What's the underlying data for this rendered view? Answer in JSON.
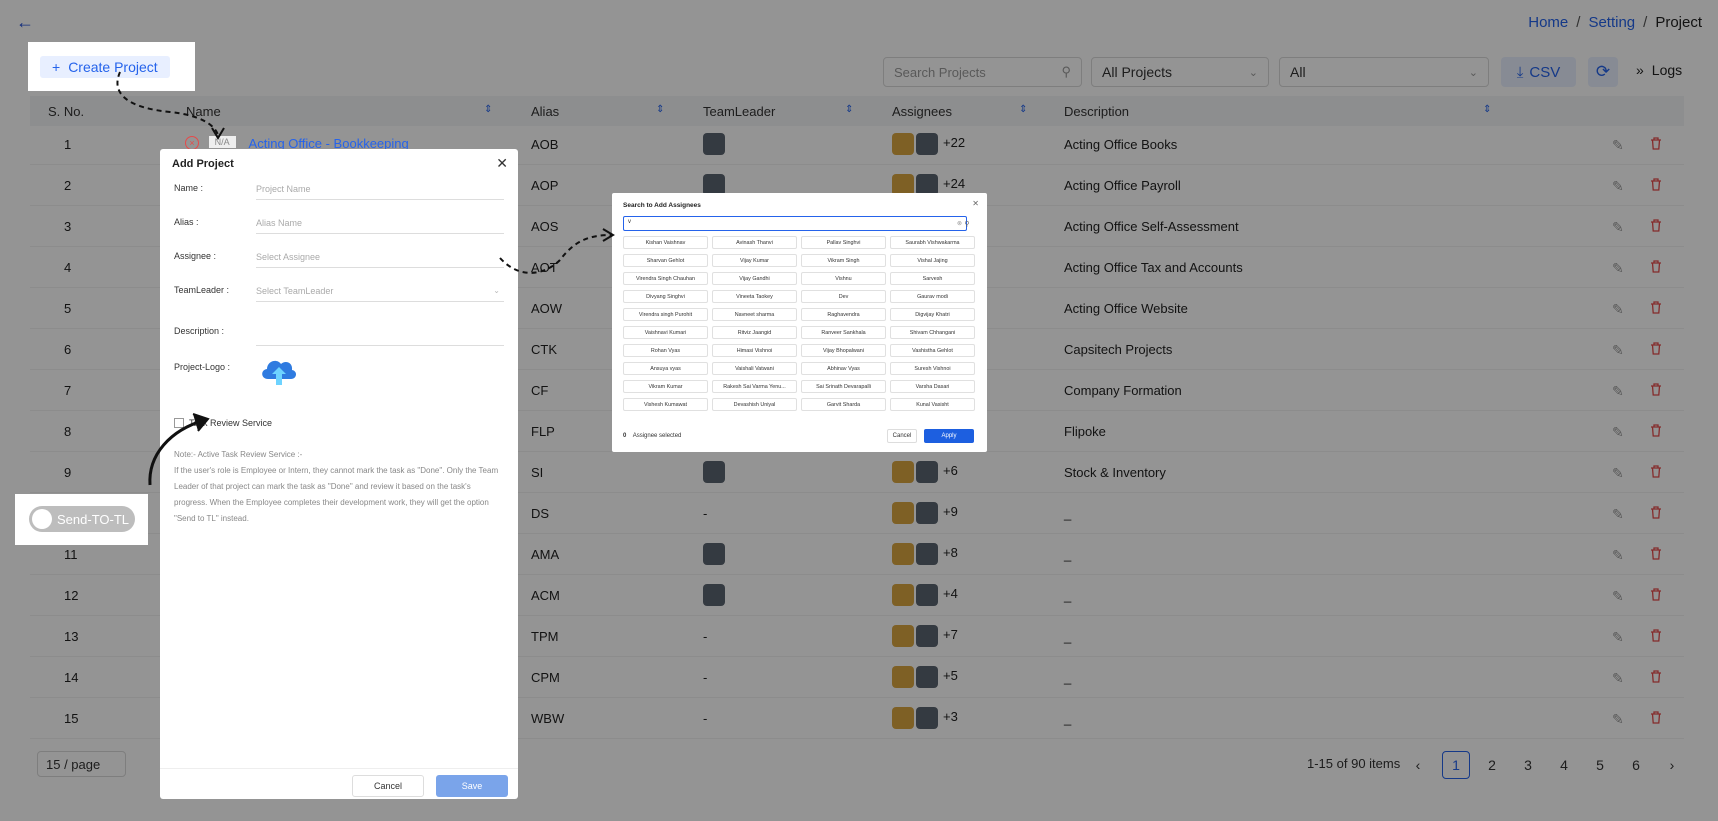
{
  "breadcrumb": {
    "home": "Home",
    "setting": "Setting",
    "project": "Project",
    "sep": "/"
  },
  "toolbar": {
    "create_label": "Create Project",
    "search_placeholder": "Search Projects",
    "filter1": "All Projects",
    "filter2": "All",
    "csv_label": "CSV",
    "logs_label": "Logs"
  },
  "table": {
    "headers": [
      "S. No.",
      "Name",
      "Alias",
      "TeamLeader",
      "Assignees",
      "Description"
    ],
    "rows": [
      {
        "no": "1",
        "alias": "AOB",
        "leader": "avatar",
        "assignees": "+22",
        "desc": "Acting Office Books"
      },
      {
        "no": "2",
        "alias": "AOP",
        "leader": "avatar",
        "assignees": "+24",
        "desc": "Acting Office Payroll"
      },
      {
        "no": "3",
        "alias": "AOS",
        "leader": "",
        "assignees": "",
        "desc": "Acting Office Self-Assessment"
      },
      {
        "no": "4",
        "alias": "AOT",
        "leader": "",
        "assignees": "",
        "desc": "Acting Office Tax and Accounts"
      },
      {
        "no": "5",
        "alias": "AOW",
        "leader": "",
        "assignees": "",
        "desc": "Acting Office Website"
      },
      {
        "no": "6",
        "alias": "CTK",
        "leader": "",
        "assignees": "",
        "desc": "Capsitech Projects"
      },
      {
        "no": "7",
        "alias": "CF",
        "leader": "",
        "assignees": "",
        "desc": "Company Formation"
      },
      {
        "no": "8",
        "alias": "FLP",
        "leader": "",
        "assignees": "",
        "desc": "Flipoke"
      },
      {
        "no": "9",
        "alias": "SI",
        "leader": "avatar",
        "assignees": "+6",
        "desc": "Stock & Inventory"
      },
      {
        "no": "10",
        "alias": "DS",
        "leader": "-",
        "assignees": "+9",
        "desc": "_"
      },
      {
        "no": "11",
        "alias": "AMA",
        "leader": "avatar",
        "assignees": "+8",
        "desc": "_"
      },
      {
        "no": "12",
        "alias": "ACM",
        "leader": "avatar",
        "assignees": "+4",
        "desc": "_"
      },
      {
        "no": "13",
        "alias": "TPM",
        "leader": "-",
        "assignees": "+7",
        "desc": "_"
      },
      {
        "no": "14",
        "alias": "CPM",
        "leader": "-",
        "assignees": "+5",
        "desc": "_"
      },
      {
        "no": "15",
        "alias": "WBW",
        "leader": "-",
        "assignees": "+3",
        "desc": "_"
      }
    ],
    "first_row_name": "Acting Office - Bookkeeping",
    "first_row_badge": "N/A"
  },
  "pager": {
    "per_page": "15 / page",
    "info": "1-15 of 90 items",
    "pages": [
      "1",
      "2",
      "3",
      "4",
      "5",
      "6"
    ],
    "current": "1"
  },
  "send_to_tl": "Send-TO-TL",
  "add_project": {
    "title": "Add Project",
    "fields": [
      {
        "label": "Name :",
        "placeholder": "Project Name"
      },
      {
        "label": "Alias :",
        "placeholder": "Alias Name"
      },
      {
        "label": "Assignee :",
        "placeholder": "Select Assignee"
      },
      {
        "label": "TeamLeader :",
        "placeholder": "Select TeamLeader"
      },
      {
        "label": "Description :",
        "placeholder": ""
      }
    ],
    "logo_label": "Project-Logo :",
    "checkbox_label": "Task Review Service",
    "note_title": "Note:- Active Task Review Service :-",
    "note_body": "If the user's role is Employee or Intern, they cannot mark the task as \"Done\". Only the Team Leader of that project can mark the task as \"Done\" and review it based on the task's progress. When the Employee completes their development work, they will get the option \"Send to TL\" instead.",
    "cancel": "Cancel",
    "save": "Save"
  },
  "assignee_search": {
    "title": "Search to Add Assignees",
    "query": "v",
    "names": [
      "Kishan Vaishnav",
      "Avinash Thanvi",
      "Pallav Singhvi",
      "Saurabh Vishwakarma",
      "Sharvan Gehlot",
      "Vijay Kumar",
      "Vikram Singh",
      "Vishal Jajing",
      "Virendra Singh Chauhan",
      "Vijay Gandhi",
      "Vishnu",
      "Sarvesh",
      "Divyang Singhvi",
      "Vineeta Taokey",
      "Dev",
      "Gaurav modi",
      "Virendra singh Purohit",
      "Navneet sharma",
      "Raghavendra",
      "Digvijay Khatri",
      "Vaishnavi Kumari",
      "Ritviz Jaangid",
      "Ranveer Sankhala",
      "Shivam Chhangani",
      "Rohan Vyas",
      "Himasi Vishnoi",
      "Vijay Bhopalwani",
      "Vashistha Gehlot",
      "Ansuya vyas",
      "Vaishali Vatwani",
      "Abhinav Vyas",
      "Suresh Vishnoi",
      "Vikram Kumar",
      "Rakesh Sai Varma Yenu...",
      "Sai Srinath Devarapalli",
      "Varsha Dasari",
      "Vishesh Kumawat",
      "Devashish Uniyal",
      "Garvit Sharda",
      "Kunal Vasisht"
    ],
    "selected_count": "0",
    "selected_label": "Assignee selected",
    "cancel": "Cancel",
    "apply": "Apply"
  },
  "colors": {
    "accent": "#2563eb",
    "delete": "#e64a4a",
    "save_btn": "#7aa4ea",
    "apply_btn": "#1d5fe0"
  },
  "icons": [
    "back-arrow-icon",
    "search-icon",
    "chevron-down-icon",
    "download-icon",
    "refresh-icon",
    "double-chevron-icon",
    "sort-icon",
    "edit-icon",
    "delete-icon",
    "close-icon",
    "cloud-upload-icon",
    "plus-icon"
  ]
}
